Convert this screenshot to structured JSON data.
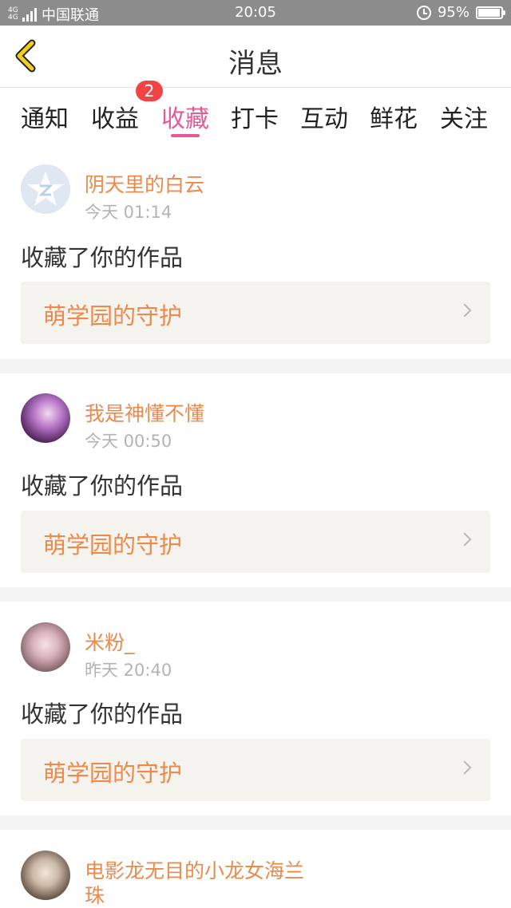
{
  "status_bar": {
    "signal_top": "4G",
    "signal_bottom": "4G",
    "carrier": "中国联通",
    "time": "20:05",
    "battery_percent": "95%",
    "battery_level": 0.95
  },
  "header": {
    "title": "消息",
    "back_icon": "chevron-left-icon",
    "back_color": "#e0b400"
  },
  "tabs": [
    {
      "label": "通知"
    },
    {
      "label": "收益",
      "badge": "2"
    },
    {
      "label": "收藏",
      "active": true
    },
    {
      "label": "打卡"
    },
    {
      "label": "互动"
    },
    {
      "label": "鲜花"
    },
    {
      "label": "关注"
    }
  ],
  "colors": {
    "accent": "#e85a95",
    "username": "#ec8a4c",
    "badge": "#f24444",
    "work_box_bg": "#f4f3ee"
  },
  "messages": [
    {
      "username": "阴天里的白云",
      "time": "今天 01:14",
      "action": "收藏了你的作品",
      "work_title": "萌学园的守护",
      "avatar": "default-avatar-icon"
    },
    {
      "username": "我是神懂不懂",
      "time": "今天 00:50",
      "action": "收藏了你的作品",
      "work_title": "萌学园的守护",
      "avatar": "user-photo"
    },
    {
      "username": "米粉_",
      "time": "昨天 20:40",
      "action": "收藏了你的作品",
      "work_title": "萌学园的守护",
      "avatar": "user-photo"
    },
    {
      "username_line1": "电影龙无目的小龙女海兰",
      "username_line2": "珠",
      "avatar": "user-photo"
    }
  ]
}
